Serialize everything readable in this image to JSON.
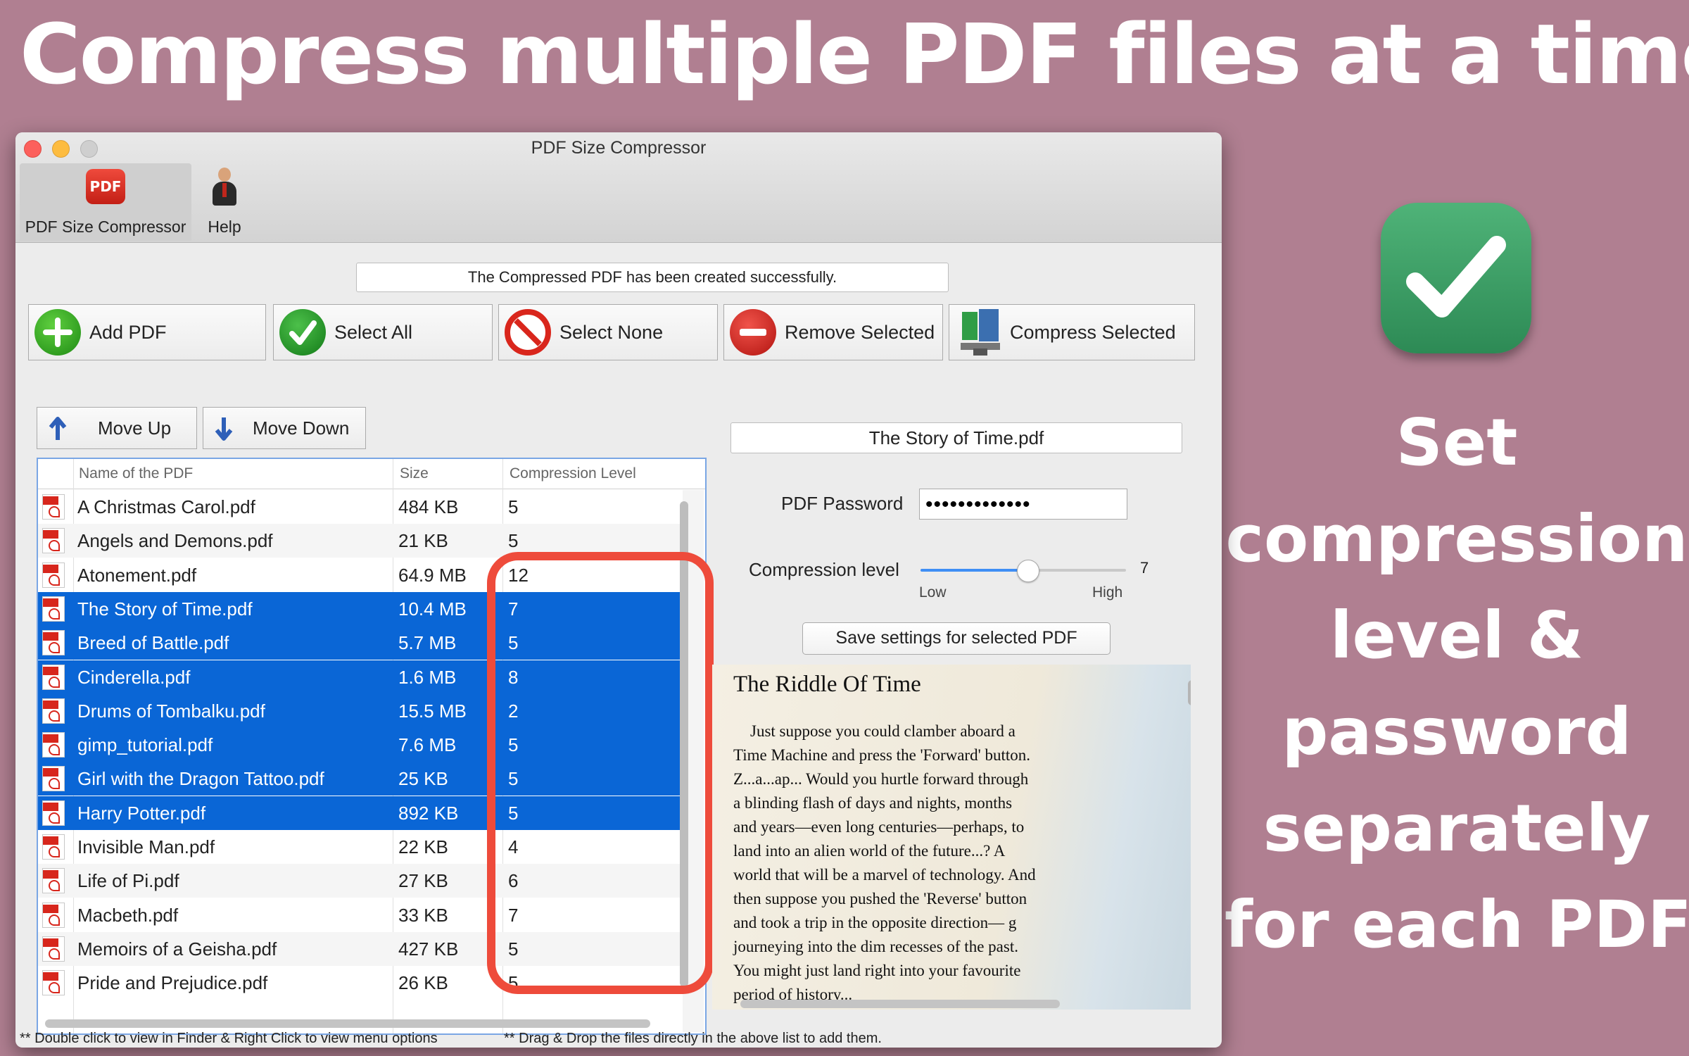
{
  "headline": "Compress multiple PDF files at a time",
  "side_text": [
    "Set",
    "compression",
    "level &",
    "password",
    "separately",
    "for each PDF"
  ],
  "window": {
    "title": "PDF Size Compressor",
    "toolbar": {
      "compressor_label": "PDF Size Compressor",
      "help_label": "Help",
      "pdf_badge": "PDF"
    }
  },
  "status_message": "The Compressed PDF has been created successfully.",
  "actions": {
    "add_pdf": "Add PDF",
    "select_all": "Select All",
    "select_none": "Select None",
    "remove_selected": "Remove Selected",
    "compress_selected": "Compress Selected"
  },
  "move": {
    "up": "Move Up",
    "down": "Move Down"
  },
  "table": {
    "headers": {
      "name": "Name of the PDF",
      "size": "Size",
      "level": "Compression Level"
    },
    "rows": [
      {
        "name": "A Christmas Carol.pdf",
        "size": "484 KB",
        "level": "5",
        "selected": false
      },
      {
        "name": "Angels and Demons.pdf",
        "size": "21 KB",
        "level": "5",
        "selected": false
      },
      {
        "name": "Atonement.pdf",
        "size": "64.9 MB",
        "level": "12",
        "selected": false
      },
      {
        "name": "The Story of Time.pdf",
        "size": "10.4 MB",
        "level": "7",
        "selected": true
      },
      {
        "name": "Breed of Battle.pdf",
        "size": "5.7 MB",
        "level": "5",
        "selected": true
      },
      {
        "name": "Cinderella.pdf",
        "size": "1.6 MB",
        "level": "8",
        "selected": true
      },
      {
        "name": "Drums of Tombalku.pdf",
        "size": "15.5 MB",
        "level": "2",
        "selected": true
      },
      {
        "name": "gimp_tutorial.pdf",
        "size": "7.6 MB",
        "level": "5",
        "selected": true
      },
      {
        "name": "Girl with the Dragon Tattoo.pdf",
        "size": "25 KB",
        "level": "5",
        "selected": true
      },
      {
        "name": "Harry Potter.pdf",
        "size": "892 KB",
        "level": "5",
        "selected": true
      },
      {
        "name": "Invisible Man.pdf",
        "size": "22 KB",
        "level": "4",
        "selected": false
      },
      {
        "name": "Life of Pi.pdf",
        "size": "27 KB",
        "level": "6",
        "selected": false
      },
      {
        "name": "Macbeth.pdf",
        "size": "33 KB",
        "level": "7",
        "selected": false
      },
      {
        "name": "Memoirs of a Geisha.pdf",
        "size": "427 KB",
        "level": "5",
        "selected": false
      },
      {
        "name": "Pride and Prejudice.pdf",
        "size": "26 KB",
        "level": "5",
        "selected": false
      }
    ]
  },
  "settings": {
    "selected_file": "The Story of Time.pdf",
    "password_label": "PDF Password",
    "password_value": "•••••••••••••",
    "level_label": "Compression level",
    "level_value": "7",
    "level_fraction": 0.52,
    "low_label": "Low",
    "high_label": "High",
    "save_label": "Save settings for selected PDF"
  },
  "preview": {
    "title": "The Riddle Of Time",
    "lines": [
      "Just suppose you could clamber aboard a",
      "Time Machine and press the 'Forward' button.",
      "Z...a...ap... Would you hurtle forward through",
      "a blinding flash of days and nights, months",
      "and years—even long centuries—perhaps, to",
      "land into an alien world of the future...? A",
      "world that will be a marvel of technology. And",
      "then suppose you pushed the 'Reverse' button",
      "and took a trip in the opposite direction— g",
      "journeying into the dim recesses of the past.",
      "You might just land right into your favourite",
      "period of history..."
    ]
  },
  "footer": {
    "left": "** Double click to view in Finder & Right Click  to view menu options",
    "right": "** Drag & Drop the files directly in the above list to add them."
  },
  "colors": {
    "background": "#b07f91",
    "selection": "#0a66d6",
    "highlight": "#ee4b3b",
    "check_green": "#3fa066"
  }
}
